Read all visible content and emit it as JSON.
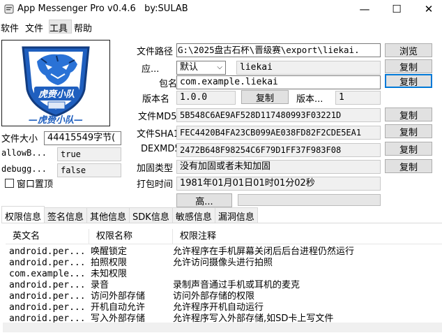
{
  "window": {
    "title": "App Messenger Pro v0.4.6   by:SULAB",
    "min_glyph": "—",
    "max_glyph": "☐",
    "close_glyph": "✕"
  },
  "menu": [
    "软件",
    "文件",
    "工具",
    "帮助"
  ],
  "logo": {
    "text_upper": "虎赍小队",
    "text_lower": "—虎赍小队—"
  },
  "left": {
    "file_size_label": "文件大小",
    "file_size_value": "44415549字节(",
    "allow_label": "allowB...",
    "allow_value": "true",
    "debug_label": "debugg...",
    "debug_value": "false",
    "pin_label": "窗口置顶"
  },
  "info": {
    "path_label": "文件路径",
    "path_value": "G:\\2025盘古石杯\\晋级赛\\export\\liekai.",
    "browse_button": "浏览",
    "app_label": "应...",
    "app_select": "默认",
    "app_value": "liekai",
    "package_label": "包名",
    "package_value": "com.example.liekai",
    "version_name_label": "版本名",
    "version_name_value": "1.0.0",
    "version_copy": "复制",
    "version_code_label": "版本...",
    "version_code_value": "1",
    "md5_label": "文件MD5",
    "md5_value": "5B548C6AE9AF528D117480993F03221D",
    "sha1_label": "文件SHA1",
    "sha1_value": "FEC4420B4FA23CB099AE038FD82F2CDE5EA1",
    "dex_label": "DEXMD5",
    "dex_value": "2472B648F98254C6F79D1FF37F983F08",
    "harden_label": "加固类型",
    "harden_value": "没有加固或者未知加固",
    "pack_label": "打包时间",
    "pack_value": "1981年01月01日01时01分02秒",
    "high_button": "高...",
    "copy": "复制"
  },
  "tabs": [
    "权限信息",
    "签名信息",
    "其他信息",
    "SDK信息",
    "敏感信息",
    "漏洞信息"
  ],
  "columns": [
    "英文名",
    "权限名称",
    "权限注释"
  ],
  "rows": [
    [
      "android.per...",
      "唤醒锁定",
      "允许程序在手机屏幕关闭后后台进程仍然运行"
    ],
    [
      "android.per...",
      "拍照权限",
      "允许访问摄像头进行拍照"
    ],
    [
      "com.example...",
      "未知权限",
      ""
    ],
    [
      "android.per...",
      "录音",
      "录制声音通过手机或耳机的麦克"
    ],
    [
      "android.per...",
      "访问外部存储",
      "访问外部存储的权限"
    ],
    [
      "android.per...",
      "开机自动允许",
      "允许程序开机自动运行"
    ],
    [
      "android.per...",
      "写入外部存储",
      "允许程序写入外部存储,如SD卡上写文件"
    ]
  ],
  "colors": {
    "accent": "#0078d7",
    "logo_blue": "#1f5fbf"
  }
}
